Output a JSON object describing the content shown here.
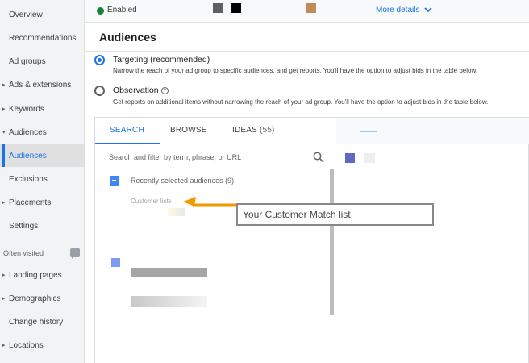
{
  "sidebar": {
    "items": [
      {
        "label": "Overview",
        "caret": false,
        "active": false
      },
      {
        "label": "Recommendations",
        "caret": false,
        "active": false
      },
      {
        "label": "Ad groups",
        "caret": false,
        "active": false
      },
      {
        "label": "Ads & extensions",
        "caret": true,
        "active": false
      },
      {
        "label": "Keywords",
        "caret": true,
        "active": false
      },
      {
        "label": "Audiences",
        "caret": true,
        "active": false,
        "expanded": true
      },
      {
        "label": "Audiences",
        "caret": false,
        "active": true
      },
      {
        "label": "Exclusions",
        "caret": false,
        "active": false
      },
      {
        "label": "Placements",
        "caret": true,
        "active": false
      },
      {
        "label": "Settings",
        "caret": false,
        "active": false
      }
    ],
    "section_label": "Often visited",
    "section_items": [
      {
        "label": "Landing pages",
        "caret": true
      },
      {
        "label": "Demographics",
        "caret": true
      },
      {
        "label": "Change history",
        "caret": false
      },
      {
        "label": "Locations",
        "caret": true
      }
    ]
  },
  "topbar": {
    "status": "Enabled",
    "more_details": "More details"
  },
  "page": {
    "title": "Audiences"
  },
  "options": {
    "targeting": {
      "title": "Targeting (recommended)",
      "description": "Narrow the reach of your ad group to specific audiences, and get reports. You'll have the option to adjust bids in the table below.",
      "selected": true
    },
    "observation": {
      "title": "Observation",
      "description": "Get reports on additional items without narrowing the reach of your ad group. You'll have the option to adjust bids in the table below.",
      "selected": false
    }
  },
  "tabs": {
    "search": "SEARCH",
    "browse": "BROWSE",
    "ideas": "IDEAS",
    "ideas_count": "(55)"
  },
  "search": {
    "placeholder": "Search and filter by term, phrase, or URL"
  },
  "list": {
    "recently_selected": "Recently selected audiences (9)",
    "customer_lists": "Customer lists"
  },
  "annotation": {
    "text": "Your Customer Match list"
  },
  "colors": {
    "accent": "#1a73e8",
    "status_green": "#188038",
    "arrow": "#f29900"
  }
}
